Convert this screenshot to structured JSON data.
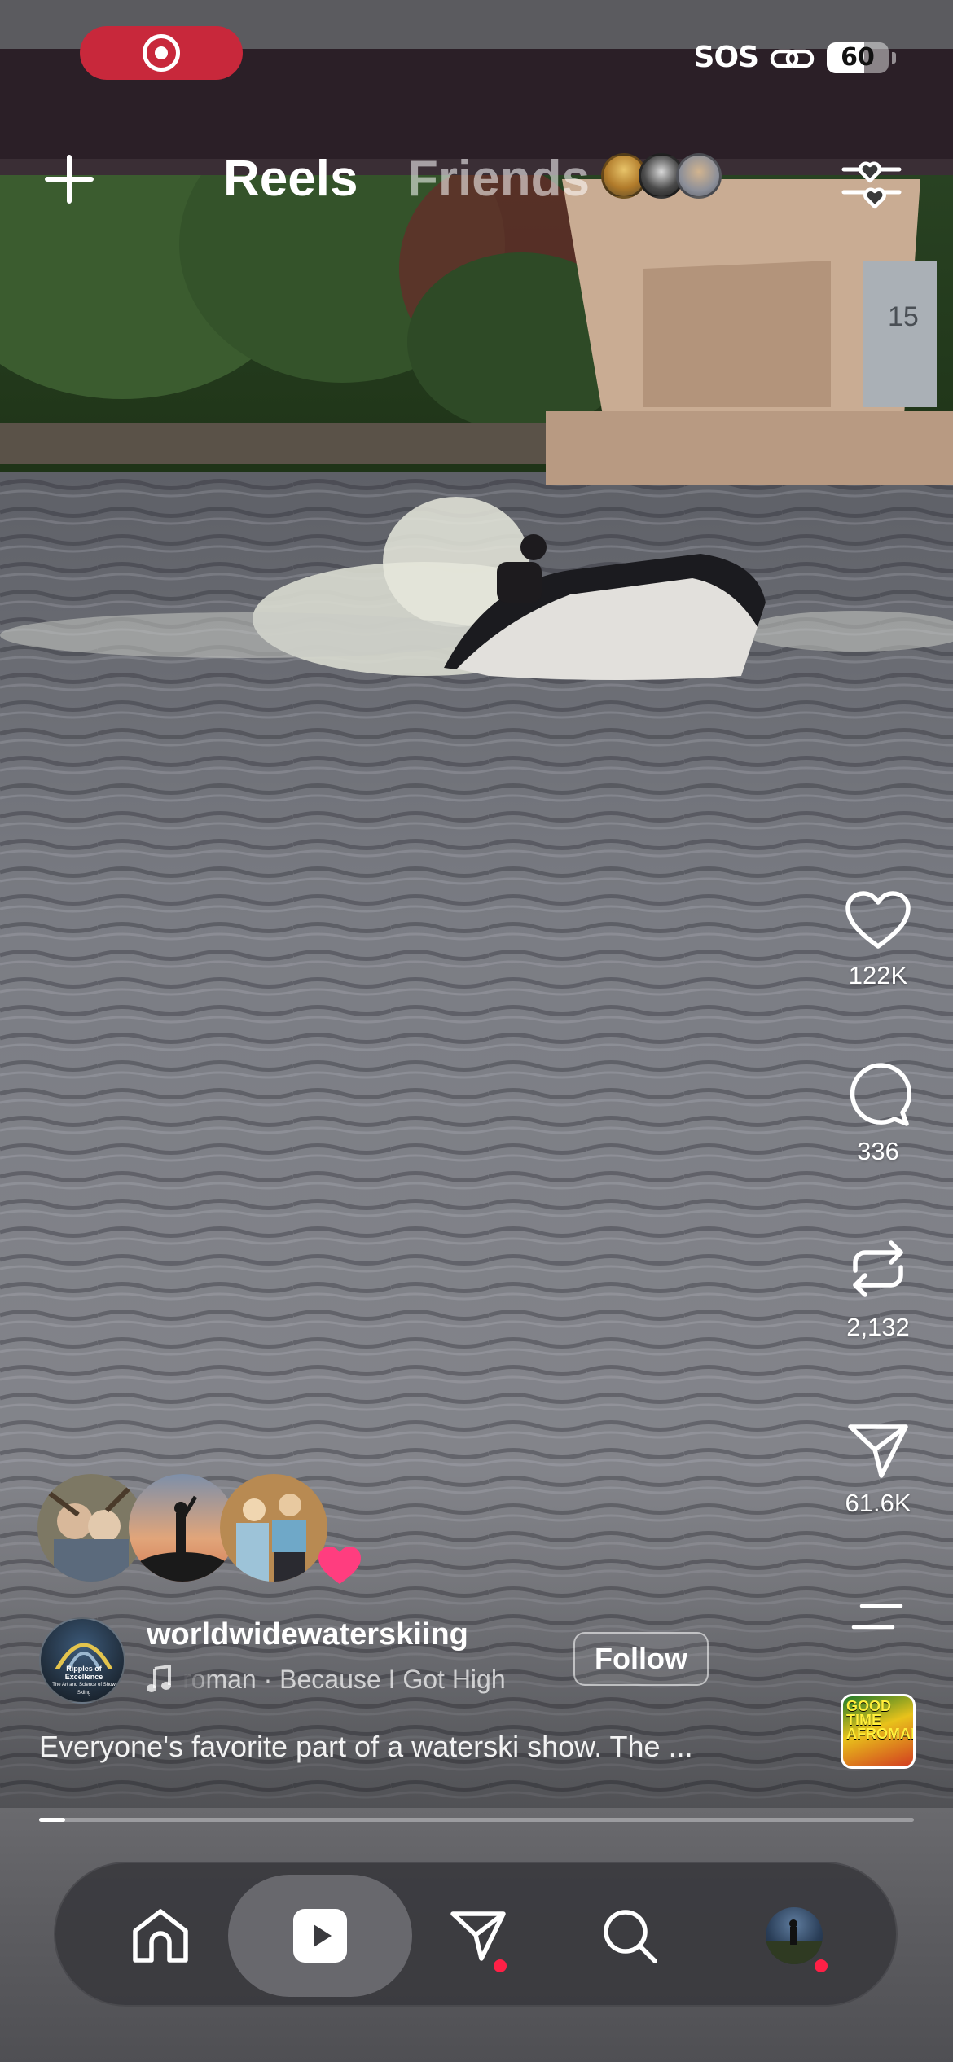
{
  "status_bar": {
    "recording_indicator": "record-icon",
    "sos_label": "SOS",
    "link_icon": "link-icon",
    "battery_level": "60",
    "battery_fraction": 0.6
  },
  "top_nav": {
    "create_icon": "plus-icon",
    "tabs": [
      {
        "label": "Reels",
        "active": true
      },
      {
        "label": "Friends",
        "active": false
      }
    ],
    "filter_icon": "heart-sliders-icon"
  },
  "actions": {
    "like": {
      "icon": "heart-icon",
      "count": "122K"
    },
    "comment": {
      "icon": "comment-icon",
      "count": "336"
    },
    "repost": {
      "icon": "repost-icon",
      "count": "2,132"
    },
    "share": {
      "icon": "paper-plane-icon",
      "count": "61.6K"
    },
    "more_icon": "menu-lines-icon"
  },
  "post": {
    "username": "worldwidewaterskiing",
    "avatar_text": "Ripples of Excellence",
    "avatar_subtext": "The Art and Science of Show Skiing",
    "music": "roman · Because I Got High",
    "follow_label": "Follow",
    "caption": "Everyone's favorite part of a waterski show. The ...",
    "audio_thumb_text": "GOOD TIME AFROMAN",
    "progress": 0.03
  },
  "tab_bar": {
    "items": [
      {
        "icon": "home-icon",
        "active": false
      },
      {
        "icon": "reels-icon",
        "active": true
      },
      {
        "icon": "direct-message-icon",
        "active": false,
        "badge": true
      },
      {
        "icon": "search-icon",
        "active": false
      },
      {
        "icon": "profile-avatar",
        "active": false,
        "badge": true
      }
    ]
  },
  "colors": {
    "recording_red": "#c8283b",
    "notification_red": "#ff2046",
    "heart_pink": "#ff3d7f"
  }
}
